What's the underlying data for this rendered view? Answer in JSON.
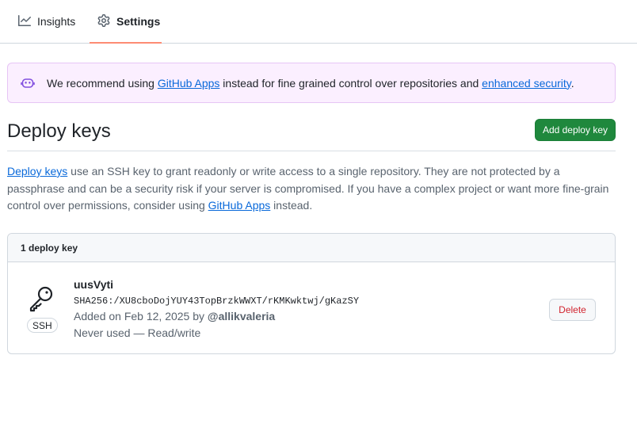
{
  "tabs": [
    {
      "label": "Insights",
      "icon": "graph-icon",
      "selected": false
    },
    {
      "label": "Settings",
      "icon": "gear-icon",
      "selected": true
    }
  ],
  "banner": {
    "icon": "copilot-icon",
    "text_1": "We recommend using ",
    "link_1": "GitHub Apps",
    "text_2": " instead for fine grained control over repositories and ",
    "link_2": "enhanced security",
    "text_3": "."
  },
  "header": {
    "title": "Deploy keys",
    "add_button": "Add deploy key"
  },
  "description": {
    "link_1": "Deploy keys",
    "text_1": " use an SSH key to grant readonly or write access to a single repository. They are not protected by a passphrase and can be a security risk if your server is compromised. If you have a complex project or want more fine-grain control over permissions, consider using ",
    "link_2": "GitHub Apps",
    "text_2": " instead."
  },
  "keys_box": {
    "count_label": "1 deploy key",
    "keys": [
      {
        "title": "uusVyti",
        "fingerprint": "SHA256:/XU8cboDojYUY43TopBrzkWWXT/rKMKwktwj/gKazSY",
        "added_prefix": "Added on Feb 12, 2025 by ",
        "added_by": "@allikvaleria",
        "usage": "Never used — Read/write",
        "badge": "SSH",
        "delete_label": "Delete"
      }
    ]
  },
  "colors": {
    "primary_button": "#1f883d",
    "link": "#0969da",
    "danger": "#d1242f",
    "tab_underline": "#fd8c73",
    "banner_bg": "#fbefff"
  }
}
